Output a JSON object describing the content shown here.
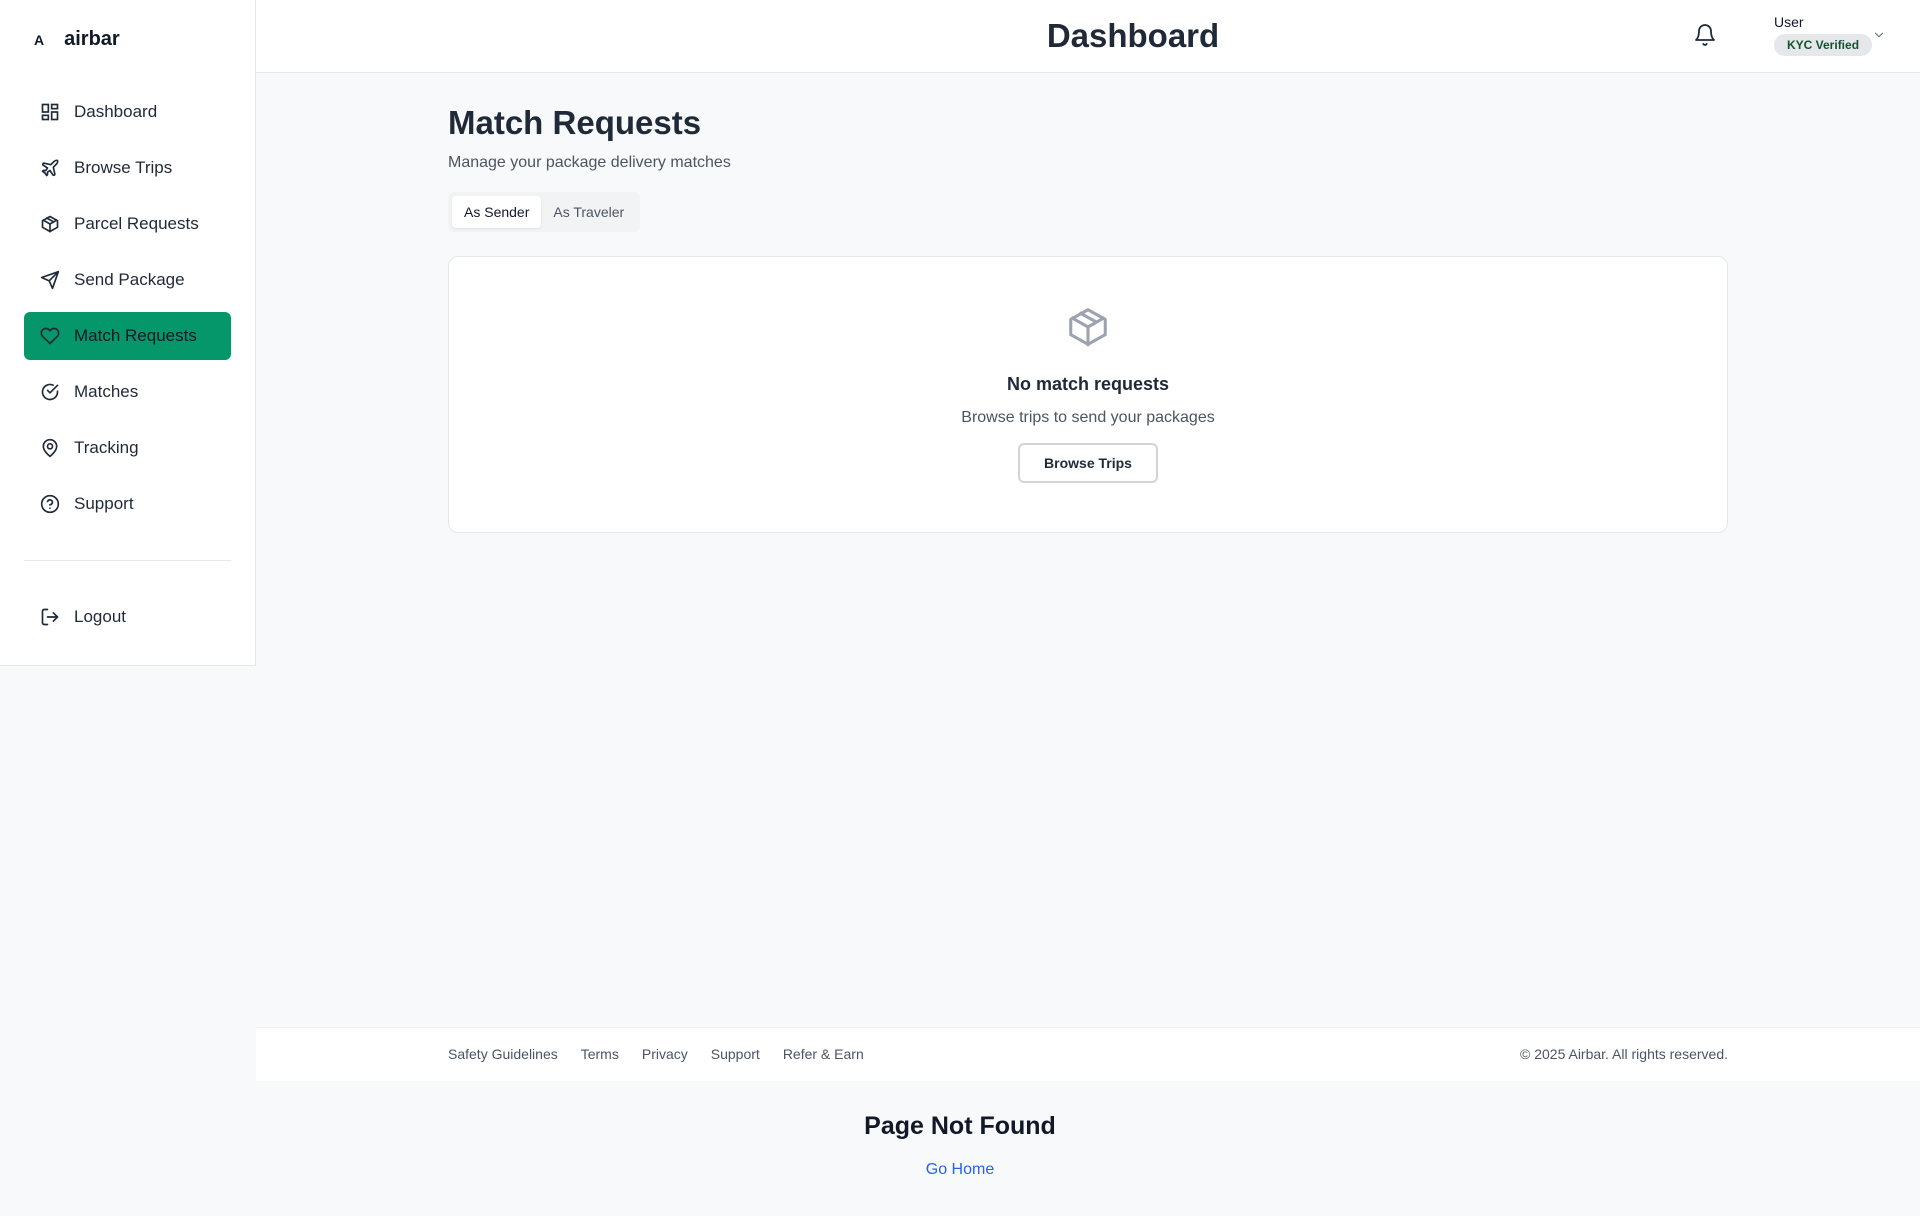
{
  "brand": {
    "mark": "A",
    "name": "airbar"
  },
  "sidebar": {
    "items": [
      {
        "label": "Dashboard",
        "icon": "dashboard-icon"
      },
      {
        "label": "Browse Trips",
        "icon": "plane-icon"
      },
      {
        "label": "Parcel Requests",
        "icon": "package-icon"
      },
      {
        "label": "Send Package",
        "icon": "send-icon"
      },
      {
        "label": "Match Requests",
        "icon": "heart-icon",
        "active": true
      },
      {
        "label": "Matches",
        "icon": "check-circle-icon"
      },
      {
        "label": "Tracking",
        "icon": "map-pin-icon"
      },
      {
        "label": "Support",
        "icon": "help-circle-icon"
      }
    ],
    "logout": "Logout"
  },
  "header": {
    "title": "Dashboard",
    "user": {
      "name": "User",
      "badge": "KYC Verified"
    }
  },
  "main": {
    "title": "Match Requests",
    "subtitle": "Manage your package delivery matches",
    "tabs": [
      {
        "label": "As Sender",
        "active": true
      },
      {
        "label": "As Traveler",
        "active": false
      }
    ],
    "empty": {
      "title": "No match requests",
      "subtitle": "Browse trips to send your packages",
      "button": "Browse Trips"
    }
  },
  "footer": {
    "links": [
      "Safety Guidelines",
      "Terms",
      "Privacy",
      "Support",
      "Refer & Earn"
    ],
    "copyright": "© 2025 Airbar. All rights reserved."
  },
  "notfound": {
    "title": "Page Not Found",
    "link": "Go Home"
  },
  "colors": {
    "accent": "#059669",
    "link": "#2563eb",
    "badge_text": "#14532d"
  }
}
